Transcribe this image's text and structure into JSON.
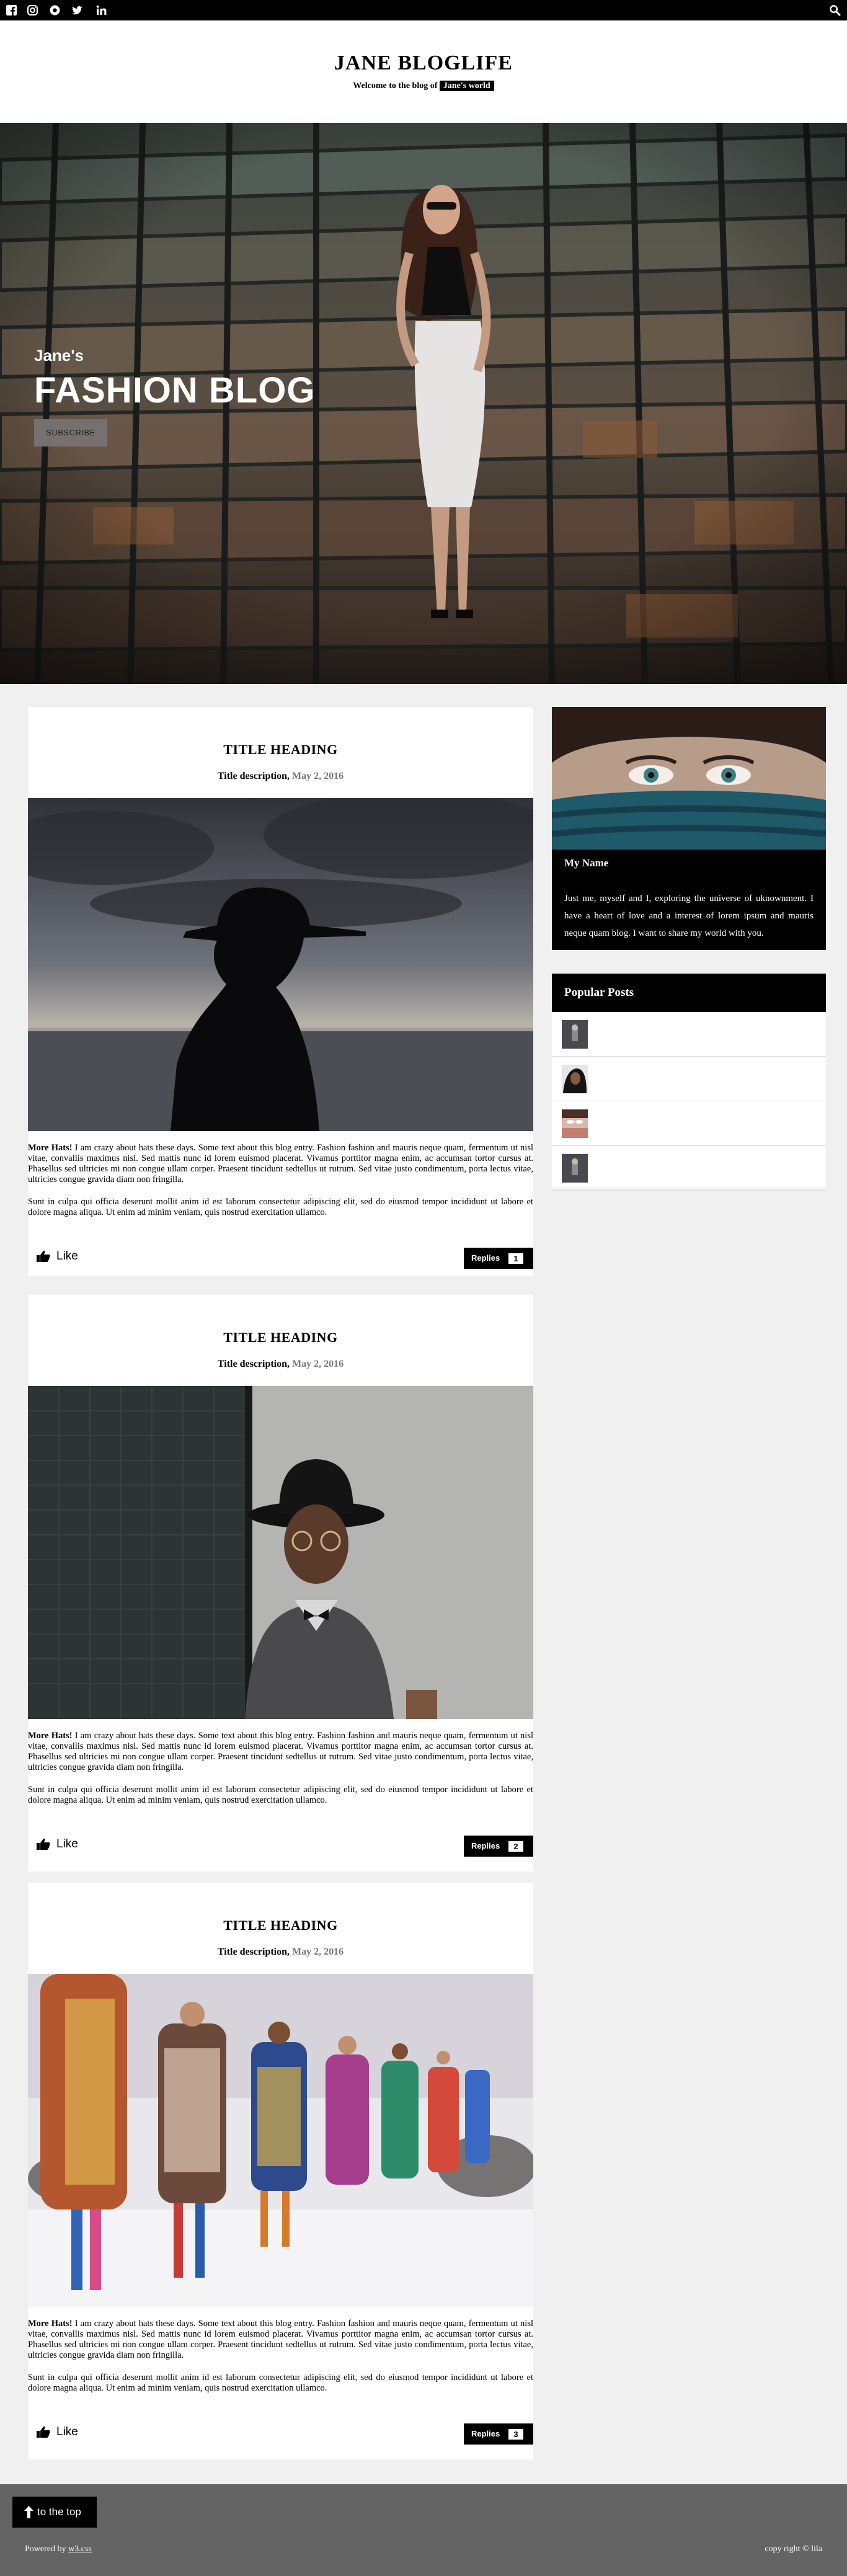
{
  "topbar": {
    "icons": [
      "facebook-icon",
      "instagram-icon",
      "snapchat-icon",
      "twitter-icon",
      "linkedin-icon"
    ],
    "search_icon": "search-icon"
  },
  "header": {
    "title": "JANE BLOGLIFE",
    "tagline_prefix": "Welcome to the blog of",
    "tagline_tag": "Jane's world"
  },
  "hero": {
    "subtitle": "Jane's",
    "title": "FASHION BLOG",
    "button": "SUBSCRIBE"
  },
  "posts": [
    {
      "title": "TITLE HEADING",
      "desc": "Title description,",
      "date": "May 2, 2016",
      "lead": "More Hats!",
      "text": "I am crazy about hats these days. Some text about this blog entry. Fashion fashion and mauris neque quam, fermentum ut nisl vitae, convallis maximus nisl. Sed mattis nunc id lorem euismod placerat. Vivamus porttitor magna enim, ac accumsan tortor cursus at. Phasellus sed ultricies mi non congue ullam corper. Praesent tincidunt sedtellus ut rutrum. Sed vitae justo condimentum, porta lectus vitae, ultricies congue gravida diam non fringilla.",
      "text2": "Sunt in culpa qui officia deserunt mollit anim id est laborum consectetur adipiscing elit, sed do eiusmod tempor incididunt ut labore et dolore magna aliqua. Ut enim ad minim veniam, quis nostrud exercitation ullamco.",
      "like": "Like",
      "replies": "Replies",
      "count": "1"
    },
    {
      "title": "TITLE HEADING",
      "desc": "Title description,",
      "date": "May 2, 2016",
      "lead": "More Hats!",
      "text": "I am crazy about hats these days. Some text about this blog entry. Fashion fashion and mauris neque quam, fermentum ut nisl vitae, convallis maximus nisl. Sed mattis nunc id lorem euismod placerat. Vivamus porttitor magna enim, ac accumsan tortor cursus at. Phasellus sed ultricies mi non congue ullam corper. Praesent tincidunt sedtellus ut rutrum. Sed vitae justo condimentum, porta lectus vitae, ultricies congue gravida diam non fringilla.",
      "text2": "Sunt in culpa qui officia deserunt mollit anim id est laborum consectetur adipiscing elit, sed do eiusmod tempor incididunt ut labore et dolore magna aliqua. Ut enim ad minim veniam, quis nostrud exercitation ullamco.",
      "like": "Like",
      "replies": "Replies",
      "count": "2"
    },
    {
      "title": "TITLE HEADING",
      "desc": "Title description,",
      "date": "May 2, 2016",
      "lead": "More Hats!",
      "text": "I am crazy about hats these days. Some text about this blog entry. Fashion fashion and mauris neque quam, fermentum ut nisl vitae, convallis maximus nisl. Sed mattis nunc id lorem euismod placerat. Vivamus porttitor magna enim, ac accumsan tortor cursus at. Phasellus sed ultricies mi non congue ullam corper. Praesent tincidunt sedtellus ut rutrum. Sed vitae justo condimentum, porta lectus vitae, ultricies congue gravida diam non fringilla.",
      "text2": "Sunt in culpa qui officia deserunt mollit anim id est laborum consectetur adipiscing elit, sed do eiusmod tempor incididunt ut labore et dolore magna aliqua. Ut enim ad minim veniam, quis nostrud exercitation ullamco.",
      "like": "Like",
      "replies": "Replies",
      "count": "3"
    }
  ],
  "about": {
    "name": "My Name",
    "text": "Just me, myself and I, exploring the universe of uknownment. I have a heart of love and a interest of lorem ipsum and mauris neque quam blog. I want to share my world with you."
  },
  "popular": {
    "title": "Popular Posts"
  },
  "footer": {
    "top_button": "to the top",
    "powered_prefix": "Powered by",
    "powered_link": "w3.css",
    "copyright": "copy right © lila"
  }
}
